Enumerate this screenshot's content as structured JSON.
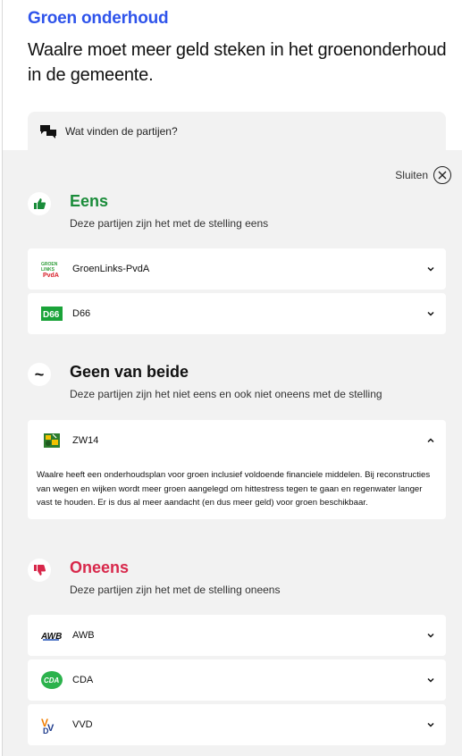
{
  "header": {
    "topic": "Groen onderhoud",
    "statement": "Waalre moet meer geld steken in het groenonderhoud in de gemeente."
  },
  "tab": {
    "label": "Wat vinden de partijen?",
    "icon": "chat-bubbles-icon"
  },
  "close": {
    "label": "Sluiten",
    "icon": "close-icon"
  },
  "colors": {
    "agree": "#1a8c3a",
    "disagree": "#d8284b",
    "neutral": "#111111",
    "topic": "#2f54eb"
  },
  "sections": {
    "agree": {
      "title": "Eens",
      "subtitle": "Deze partijen zijn het met de stelling eens",
      "icon": "thumbs-up-icon",
      "parties": [
        {
          "name": "GroenLinks-PvdA",
          "logo": "groenlinks-pvda-logo",
          "logo_text": "GROEN LINKS PvdA",
          "expanded": false
        },
        {
          "name": "D66",
          "logo": "d66-logo",
          "logo_text": "D66",
          "expanded": false
        }
      ]
    },
    "neutral": {
      "title": "Geen van beide",
      "subtitle": "Deze partijen zijn het niet eens en ook niet oneens met de stelling",
      "icon": "tilde-icon",
      "icon_text": "~",
      "parties": [
        {
          "name": "ZW14",
          "logo": "zw14-logo",
          "expanded": true,
          "explanation": "Waalre heeft een onderhoudsplan voor groen inclusief voldoende financiele middelen. Bij reconstructies van wegen en wijken wordt meer groen aangelegd om hittestress tegen te gaan en regenwater langer vast te houden. Er is dus al meer aandacht (en dus meer geld) voor groen beschikbaar."
        }
      ]
    },
    "disagree": {
      "title": "Oneens",
      "subtitle": "Deze partijen zijn het met de stelling oneens",
      "icon": "thumbs-down-icon",
      "parties": [
        {
          "name": "AWB",
          "logo": "awb-logo",
          "logo_text": "AWB",
          "expanded": false
        },
        {
          "name": "CDA",
          "logo": "cda-logo",
          "logo_text": "CDA",
          "expanded": false
        },
        {
          "name": "VVD",
          "logo": "vvd-logo",
          "logo_text": "VVD",
          "expanded": false
        }
      ]
    }
  }
}
